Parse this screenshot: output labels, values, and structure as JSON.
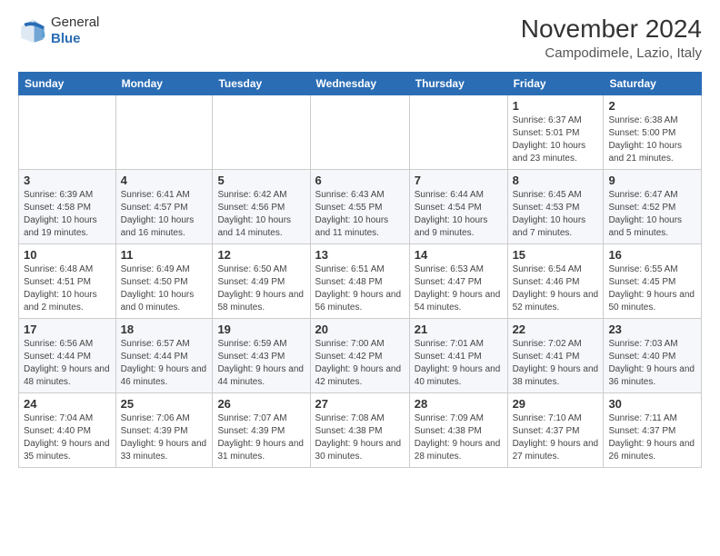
{
  "header": {
    "logo_general": "General",
    "logo_blue": "Blue",
    "month_title": "November 2024",
    "location": "Campodimele, Lazio, Italy"
  },
  "days_of_week": [
    "Sunday",
    "Monday",
    "Tuesday",
    "Wednesday",
    "Thursday",
    "Friday",
    "Saturday"
  ],
  "weeks": [
    [
      {
        "day": "",
        "text": ""
      },
      {
        "day": "",
        "text": ""
      },
      {
        "day": "",
        "text": ""
      },
      {
        "day": "",
        "text": ""
      },
      {
        "day": "",
        "text": ""
      },
      {
        "day": "1",
        "text": "Sunrise: 6:37 AM\nSunset: 5:01 PM\nDaylight: 10 hours and 23 minutes."
      },
      {
        "day": "2",
        "text": "Sunrise: 6:38 AM\nSunset: 5:00 PM\nDaylight: 10 hours and 21 minutes."
      }
    ],
    [
      {
        "day": "3",
        "text": "Sunrise: 6:39 AM\nSunset: 4:58 PM\nDaylight: 10 hours and 19 minutes."
      },
      {
        "day": "4",
        "text": "Sunrise: 6:41 AM\nSunset: 4:57 PM\nDaylight: 10 hours and 16 minutes."
      },
      {
        "day": "5",
        "text": "Sunrise: 6:42 AM\nSunset: 4:56 PM\nDaylight: 10 hours and 14 minutes."
      },
      {
        "day": "6",
        "text": "Sunrise: 6:43 AM\nSunset: 4:55 PM\nDaylight: 10 hours and 11 minutes."
      },
      {
        "day": "7",
        "text": "Sunrise: 6:44 AM\nSunset: 4:54 PM\nDaylight: 10 hours and 9 minutes."
      },
      {
        "day": "8",
        "text": "Sunrise: 6:45 AM\nSunset: 4:53 PM\nDaylight: 10 hours and 7 minutes."
      },
      {
        "day": "9",
        "text": "Sunrise: 6:47 AM\nSunset: 4:52 PM\nDaylight: 10 hours and 5 minutes."
      }
    ],
    [
      {
        "day": "10",
        "text": "Sunrise: 6:48 AM\nSunset: 4:51 PM\nDaylight: 10 hours and 2 minutes."
      },
      {
        "day": "11",
        "text": "Sunrise: 6:49 AM\nSunset: 4:50 PM\nDaylight: 10 hours and 0 minutes."
      },
      {
        "day": "12",
        "text": "Sunrise: 6:50 AM\nSunset: 4:49 PM\nDaylight: 9 hours and 58 minutes."
      },
      {
        "day": "13",
        "text": "Sunrise: 6:51 AM\nSunset: 4:48 PM\nDaylight: 9 hours and 56 minutes."
      },
      {
        "day": "14",
        "text": "Sunrise: 6:53 AM\nSunset: 4:47 PM\nDaylight: 9 hours and 54 minutes."
      },
      {
        "day": "15",
        "text": "Sunrise: 6:54 AM\nSunset: 4:46 PM\nDaylight: 9 hours and 52 minutes."
      },
      {
        "day": "16",
        "text": "Sunrise: 6:55 AM\nSunset: 4:45 PM\nDaylight: 9 hours and 50 minutes."
      }
    ],
    [
      {
        "day": "17",
        "text": "Sunrise: 6:56 AM\nSunset: 4:44 PM\nDaylight: 9 hours and 48 minutes."
      },
      {
        "day": "18",
        "text": "Sunrise: 6:57 AM\nSunset: 4:44 PM\nDaylight: 9 hours and 46 minutes."
      },
      {
        "day": "19",
        "text": "Sunrise: 6:59 AM\nSunset: 4:43 PM\nDaylight: 9 hours and 44 minutes."
      },
      {
        "day": "20",
        "text": "Sunrise: 7:00 AM\nSunset: 4:42 PM\nDaylight: 9 hours and 42 minutes."
      },
      {
        "day": "21",
        "text": "Sunrise: 7:01 AM\nSunset: 4:41 PM\nDaylight: 9 hours and 40 minutes."
      },
      {
        "day": "22",
        "text": "Sunrise: 7:02 AM\nSunset: 4:41 PM\nDaylight: 9 hours and 38 minutes."
      },
      {
        "day": "23",
        "text": "Sunrise: 7:03 AM\nSunset: 4:40 PM\nDaylight: 9 hours and 36 minutes."
      }
    ],
    [
      {
        "day": "24",
        "text": "Sunrise: 7:04 AM\nSunset: 4:40 PM\nDaylight: 9 hours and 35 minutes."
      },
      {
        "day": "25",
        "text": "Sunrise: 7:06 AM\nSunset: 4:39 PM\nDaylight: 9 hours and 33 minutes."
      },
      {
        "day": "26",
        "text": "Sunrise: 7:07 AM\nSunset: 4:39 PM\nDaylight: 9 hours and 31 minutes."
      },
      {
        "day": "27",
        "text": "Sunrise: 7:08 AM\nSunset: 4:38 PM\nDaylight: 9 hours and 30 minutes."
      },
      {
        "day": "28",
        "text": "Sunrise: 7:09 AM\nSunset: 4:38 PM\nDaylight: 9 hours and 28 minutes."
      },
      {
        "day": "29",
        "text": "Sunrise: 7:10 AM\nSunset: 4:37 PM\nDaylight: 9 hours and 27 minutes."
      },
      {
        "day": "30",
        "text": "Sunrise: 7:11 AM\nSunset: 4:37 PM\nDaylight: 9 hours and 26 minutes."
      }
    ]
  ]
}
